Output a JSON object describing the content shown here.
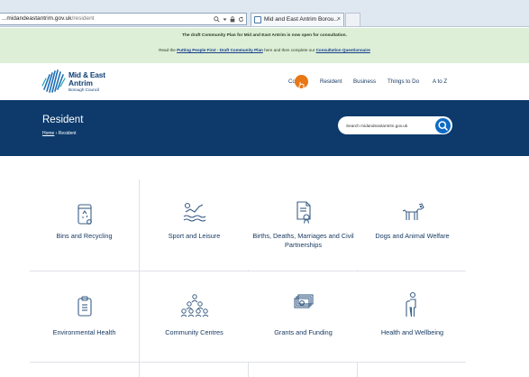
{
  "browser": {
    "url_prefix": "...midandeastantrim.gov.uk",
    "url_path": "/resident",
    "tab_title": "Mid and East Antrim Borou...",
    "tab_close": "×"
  },
  "banner": {
    "headline": "The draft Community Plan for Mid and East Antrim is now open for consultation.",
    "text_before": "Read the ",
    "link1": "Putting People First - Draft Community Plan",
    "text_middle": " here and then complete our ",
    "link2": "Consultation Questionnaire"
  },
  "logo": {
    "name_line1": "Mid & East",
    "name_line2": "Antrim",
    "subtitle": "Borough Council"
  },
  "nav": {
    "accessibility_prefix": "Co",
    "items": [
      "Resident",
      "Business",
      "Things to Do",
      "A to Z"
    ]
  },
  "hero": {
    "title": "Resident",
    "breadcrumb_home": "Home",
    "breadcrumb_separator": " › ",
    "breadcrumb_current": "Resident"
  },
  "search": {
    "placeholder": "Search midandeastantrim.gov.uk"
  },
  "tiles": [
    {
      "label": "Bins and Recycling",
      "icon": "recycling-bin-icon"
    },
    {
      "label": "Sport and Leisure",
      "icon": "swimmer-icon"
    },
    {
      "label": "Births, Deaths, Marriages and Civil Partnerships",
      "icon": "certificate-icon"
    },
    {
      "label": "Dogs and Animal Welfare",
      "icon": "dog-icon"
    },
    {
      "label": "Environmental Health",
      "icon": "clipboard-icon"
    },
    {
      "label": "Community Centres",
      "icon": "community-people-icon"
    },
    {
      "label": "Grants and Funding",
      "icon": "money-notes-icon"
    },
    {
      "label": "Health and Wellbeing",
      "icon": "health-person-icon"
    }
  ],
  "colors": {
    "brand_navy": "#0d3a6b",
    "banner_green": "#ddefd6",
    "accent_orange": "#e87715",
    "search_blue": "#0f6ac4",
    "icon_stroke": "#3b5f86"
  }
}
